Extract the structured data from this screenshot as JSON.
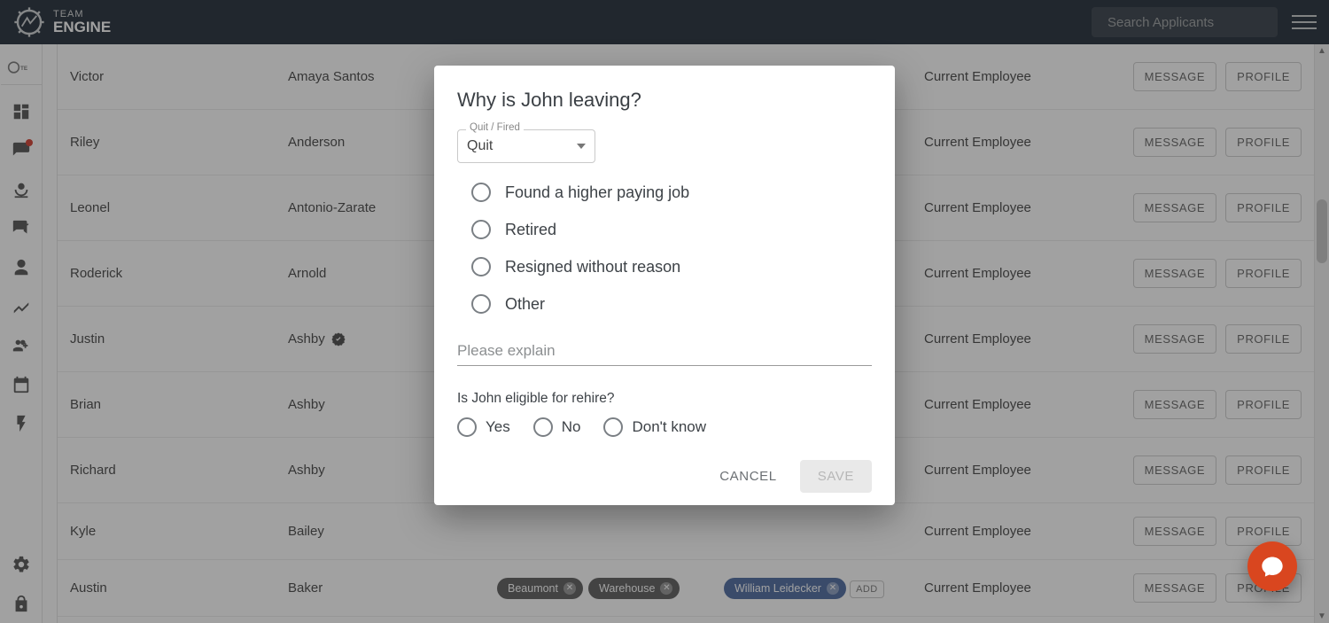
{
  "brand": {
    "top": "TEAM",
    "bottom": "ENGINE"
  },
  "search": {
    "placeholder": "Search Applicants"
  },
  "table": {
    "status_label": "Current Employee",
    "message_label": "MESSAGE",
    "profile_label": "PROFILE",
    "add_label": "ADD",
    "rows": [
      {
        "first": "Victor",
        "last": "Amaya Santos"
      },
      {
        "first": "Riley",
        "last": "Anderson"
      },
      {
        "first": "Leonel",
        "last": "Antonio-Zarate"
      },
      {
        "first": "Roderick",
        "last": "Arnold"
      },
      {
        "first": "Justin",
        "last": "Ashby",
        "verified": true
      },
      {
        "first": "Brian",
        "last": "Ashby"
      },
      {
        "first": "Richard",
        "last": "Ashby"
      },
      {
        "first": "Kyle",
        "last": "Bailey"
      },
      {
        "first": "Austin",
        "last": "Baker",
        "tags": [
          "Beaumont",
          "Warehouse"
        ],
        "manager": "William Leidecker"
      }
    ]
  },
  "dialog": {
    "title": "Why is John leaving?",
    "select_label": "Quit / Fired",
    "select_value": "Quit",
    "reasons": [
      "Found a higher paying job",
      "Retired",
      "Resigned without reason",
      "Other"
    ],
    "explain_placeholder": "Please explain",
    "rehire_question": "Is John eligible for rehire?",
    "rehire_options": [
      "Yes",
      "No",
      "Don't know"
    ],
    "cancel": "CANCEL",
    "save": "SAVE"
  }
}
